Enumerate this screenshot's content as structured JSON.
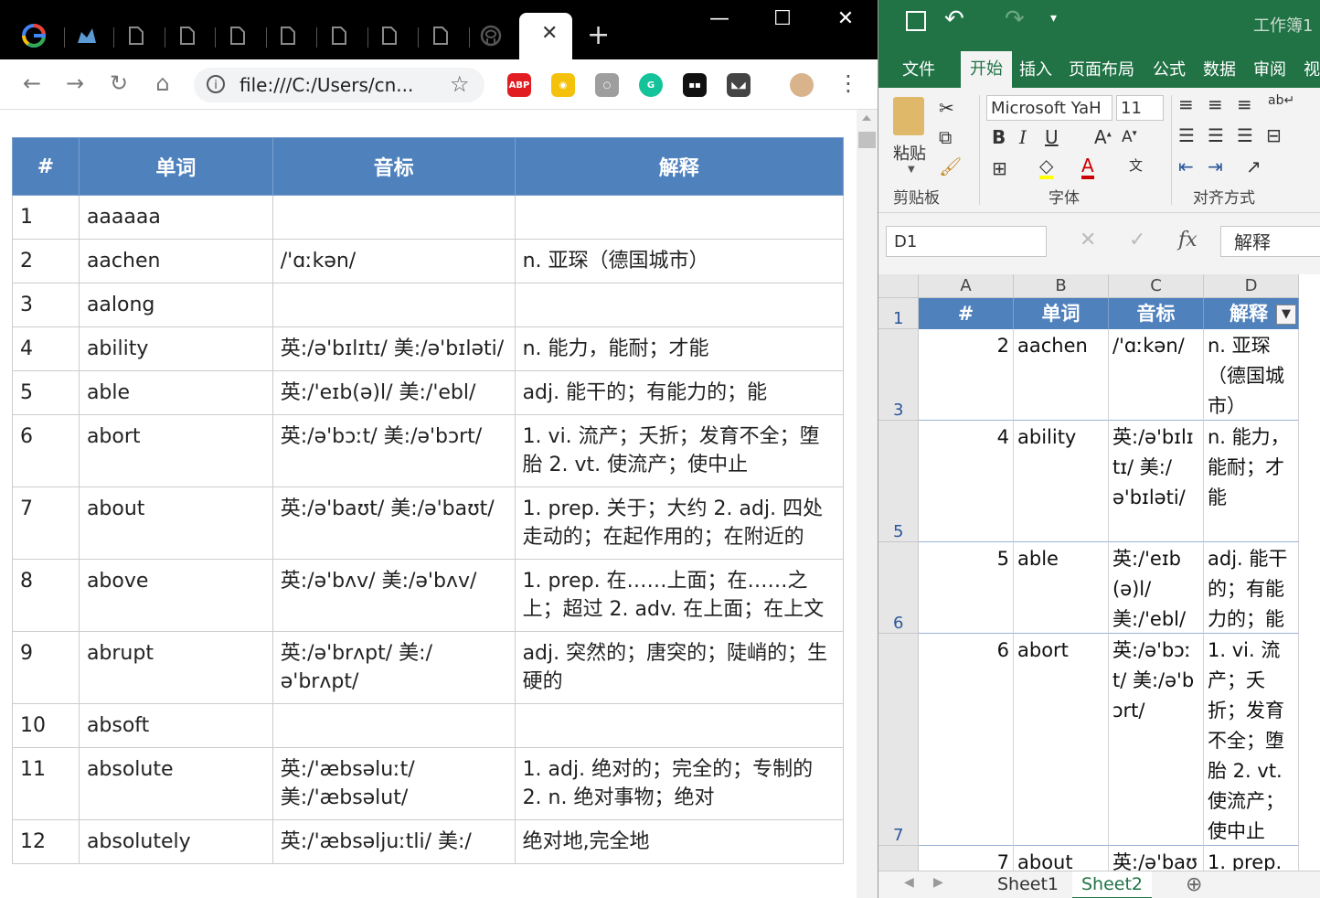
{
  "chrome": {
    "tab_icons": [
      "google-icon",
      "extension-icon",
      "file-icon",
      "file-icon",
      "file-icon",
      "file-icon",
      "file-icon",
      "file-icon",
      "file-icon",
      "github-icon"
    ],
    "active_tab_close": "✕",
    "new_tab": "+",
    "window_controls": {
      "minimize": "—",
      "maximize": "☐",
      "close": "✕"
    },
    "url": "file:///C:/Users/cn...",
    "extensions": [
      {
        "label": "ABP",
        "color": "#e11d21"
      },
      {
        "label": "◉",
        "color": "#f4c20d"
      },
      {
        "label": "○",
        "color": "#9e9e9e"
      },
      {
        "label": "G",
        "color": "#15c39a"
      },
      {
        "label": "▪▪",
        "color": "#111111"
      },
      {
        "label": "◣◢",
        "color": "#444444"
      }
    ],
    "page": {
      "headers": [
        "#",
        "单词",
        "音标",
        "解释"
      ],
      "rows": [
        {
          "n": "1",
          "word": "aaaaaa",
          "phonetic": "",
          "meaning": ""
        },
        {
          "n": "2",
          "word": "aachen",
          "phonetic": "/'ɑːkən/",
          "meaning": "n. 亚琛（德国城市）"
        },
        {
          "n": "3",
          "word": "aalong",
          "phonetic": "",
          "meaning": ""
        },
        {
          "n": "4",
          "word": "ability",
          "phonetic": "英:/ə'bɪlɪtɪ/ 美:/ə'bɪləti/",
          "meaning": "n. 能力，能耐；才能"
        },
        {
          "n": "5",
          "word": "able",
          "phonetic": "英:/'eɪb(ə)l/ 美:/'ebl/",
          "meaning": "adj. 能干的；有能力的；能"
        },
        {
          "n": "6",
          "word": "abort",
          "phonetic": "英:/ə'bɔːt/ 美:/ə'bɔrt/",
          "meaning": "1. vi. 流产；夭折；发育不全；堕胎 2. vt. 使流产；使中止"
        },
        {
          "n": "7",
          "word": "about",
          "phonetic": "英:/ə'baʊt/ 美:/ə'baʊt/",
          "meaning": "1. prep. 关于；大约 2. adj. 四处走动的；在起作用的；在附近的"
        },
        {
          "n": "8",
          "word": "above",
          "phonetic": "英:/ə'bʌv/ 美:/ə'bʌv/",
          "meaning": "1. prep. 在……上面；在……之上；超过 2. adv. 在上面；在上文"
        },
        {
          "n": "9",
          "word": "abrupt",
          "phonetic": "英:/ə'brʌpt/ 美:/ ə'brʌpt/",
          "meaning": "adj. 突然的；唐突的；陡峭的；生硬的"
        },
        {
          "n": "10",
          "word": "absoft",
          "phonetic": "",
          "meaning": ""
        },
        {
          "n": "11",
          "word": "absolute",
          "phonetic": "英:/'æbsəluːt/ 美:/'æbsəlut/",
          "meaning": "1. adj. 绝对的；完全的；专制的 2. n. 绝对事物；绝对"
        },
        {
          "n": "12",
          "word": "absolutely",
          "phonetic": "英:/'æbsəljuːtli/ 美:/",
          "meaning": "绝对地,完全地"
        }
      ]
    }
  },
  "excel": {
    "title": "工作簿1",
    "ribbon_tabs": [
      "文件",
      "开始",
      "插入",
      "页面布局",
      "公式",
      "数据",
      "审阅",
      "视"
    ],
    "groups": {
      "clipboard": "剪贴板",
      "font": "字体",
      "alignment": "对齐方式"
    },
    "paste_label": "粘贴",
    "font_name": "Microsoft YaH",
    "font_size": "11",
    "name_box": "D1",
    "formula_value": "解释",
    "fx": "fx",
    "columns": [
      "A",
      "B",
      "C",
      "D"
    ],
    "header_row": {
      "row": "1",
      "cells": [
        "#",
        "单词",
        "音标",
        "解释"
      ]
    },
    "rows": [
      {
        "row": "3",
        "a": "2",
        "b": "aachen",
        "c": "/'ɑːkən/",
        "d": "n. 亚琛（德国城市）"
      },
      {
        "row": "5",
        "a": "4",
        "b": "ability",
        "c": "英:/ə'bɪlɪtɪ/ 美:/ə'bɪləti/",
        "d": "n. 能力，能耐；才能"
      },
      {
        "row": "6",
        "a": "5",
        "b": "able",
        "c": "英:/'eɪb(ə)l/ 美:/'ebl/",
        "d": "adj. 能干的；有能力的；能"
      },
      {
        "row": "7",
        "a": "6",
        "b": "abort",
        "c": "英:/ə'bɔːt/ 美:/ə'bɔrt/",
        "d": "1. vi. 流产；夭折；发育不全；堕胎 2. vt. 使流产；使中止"
      },
      {
        "row": "",
        "a": "7",
        "b": "about",
        "c": "英:/ə'baʊ",
        "d": "1. prep."
      }
    ],
    "sheets": [
      "Sheet1",
      "Sheet2"
    ],
    "active_sheet": "Sheet2",
    "add_sheet": "⊕",
    "accent": "#217346",
    "table_header_color": "#4f81bd"
  }
}
